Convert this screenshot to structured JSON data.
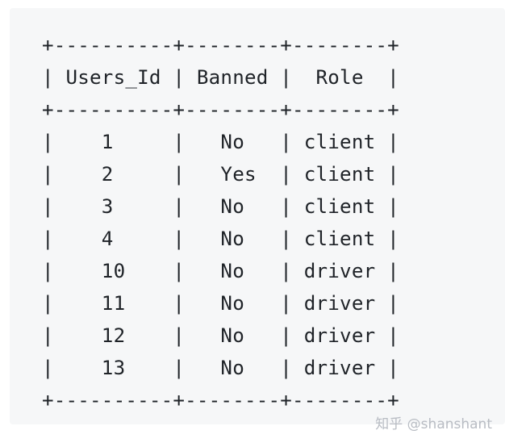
{
  "table": {
    "border": "+----------+--------+--------+",
    "header": "| Users_Id | Banned |  Role  |",
    "rows": [
      "|    1     |   No   | client |",
      "|    2     |   Yes  | client |",
      "|    3     |   No   | client |",
      "|    4     |   No   | client |",
      "|    10    |   No   | driver |",
      "|    11    |   No   | driver |",
      "|    12    |   No   | driver |",
      "|    13    |   No   | driver |"
    ]
  },
  "watermark": "知乎 @shanshant"
}
